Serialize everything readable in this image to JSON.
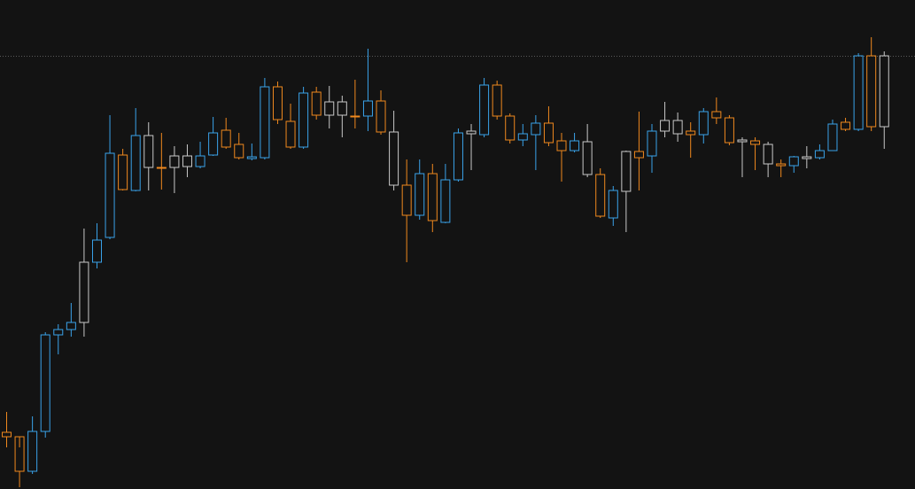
{
  "chart": {
    "kind": "candlestick"
  }
}
